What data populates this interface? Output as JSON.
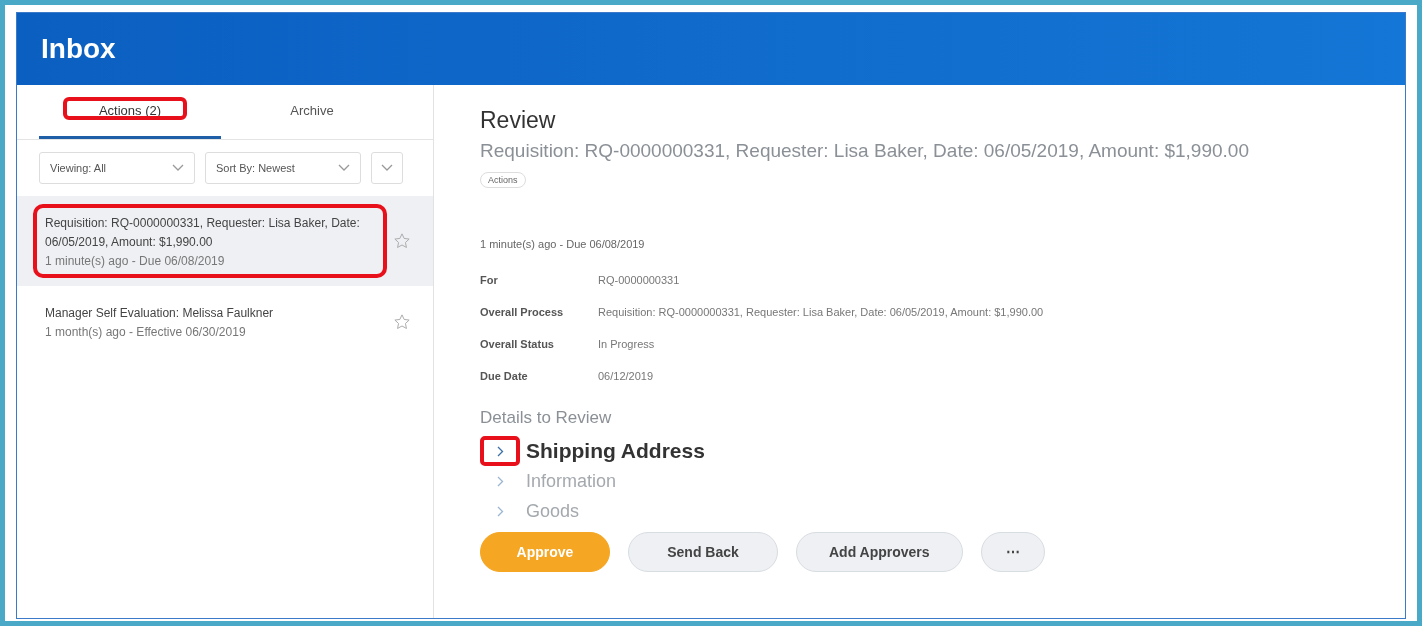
{
  "header": {
    "title": "Inbox"
  },
  "tabs": [
    {
      "label": "Actions (2)",
      "selected": true,
      "highlighted": true
    },
    {
      "label": "Archive",
      "selected": false,
      "highlighted": false
    }
  ],
  "filters": [
    {
      "label": "Viewing: All"
    },
    {
      "label": "Sort By: Newest"
    }
  ],
  "inbox_items": [
    {
      "title": "Requisition: RQ-0000000331, Requester: Lisa Baker, Date: 06/05/2019, Amount: $1,990.00",
      "meta": "1 minute(s) ago - Due 06/08/2019",
      "selected": true,
      "highlighted": true
    },
    {
      "title": "Manager Self Evaluation: Melissa Faulkner",
      "meta": "1 month(s) ago - Effective 06/30/2019",
      "selected": false,
      "highlighted": false
    }
  ],
  "detail": {
    "title": "Review",
    "subtitle": "Requisition: RQ-0000000331, Requester: Lisa Baker, Date: 06/05/2019, Amount: $1,990.00",
    "tag": "Actions",
    "meta": "1 minute(s) ago - Due 06/08/2019",
    "fields": [
      {
        "label": "For",
        "value": "RQ-0000000331"
      },
      {
        "label": "Overall Process",
        "value": "Requisition: RQ-0000000331, Requester: Lisa Baker, Date: 06/05/2019, Amount: $1,990.00"
      },
      {
        "label": "Overall Status",
        "value": "In Progress"
      },
      {
        "label": "Due Date",
        "value": "06/12/2019"
      }
    ],
    "section_heading": "Details to Review",
    "sections": [
      {
        "title": "Shipping Address",
        "highlighted": true,
        "faded": false
      },
      {
        "title": "Information",
        "highlighted": false,
        "faded": true
      },
      {
        "title": "Goods",
        "highlighted": false,
        "faded": true
      }
    ]
  },
  "buttons": [
    {
      "label": "Approve",
      "kind": "primary"
    },
    {
      "label": "Send Back",
      "kind": "secondary"
    },
    {
      "label": "Add Approvers",
      "kind": "secondary"
    },
    {
      "label": "⋯",
      "kind": "more"
    }
  ]
}
